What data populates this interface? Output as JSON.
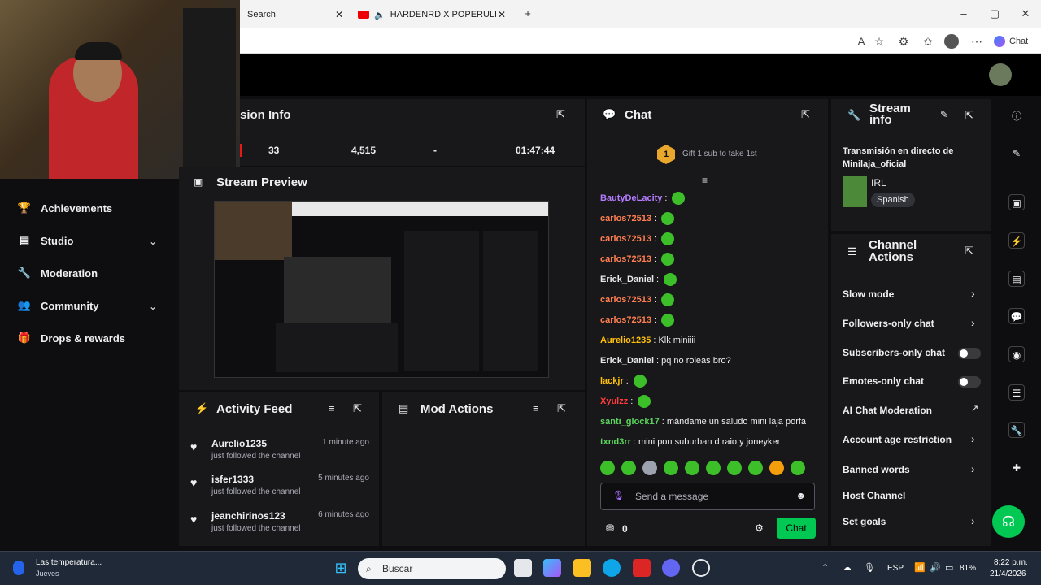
{
  "browser": {
    "tabs": [
      {
        "label": "Search"
      },
      {
        "label": "HARDENRD X POPERULIN - U"
      }
    ],
    "chat_button": "Chat"
  },
  "stats_bar": {
    "title_fragment": "sion Info",
    "values": [
      "33",
      "4,515",
      "-",
      "01:47:44"
    ]
  },
  "stream_preview": {
    "title": "Stream Preview"
  },
  "sidebar": {
    "items": [
      {
        "label": "Achievements",
        "icon": "trophy-icon",
        "expandable": false
      },
      {
        "label": "Studio",
        "icon": "studio-icon",
        "expandable": true
      },
      {
        "label": "Moderation",
        "icon": "wrench-icon",
        "expandable": false
      },
      {
        "label": "Community",
        "icon": "people-icon",
        "expandable": true
      },
      {
        "label": "Drops & rewards",
        "icon": "gift-icon",
        "expandable": false
      }
    ]
  },
  "activity_feed": {
    "title": "Activity Feed",
    "items": [
      {
        "user": "Aurelio1235",
        "time": "1 minute ago",
        "event": "just followed the channel"
      },
      {
        "user": "isfer1333",
        "time": "5 minutes ago",
        "event": "just followed the channel"
      },
      {
        "user": "jeanchirinos123",
        "time": "6 minutes ago",
        "event": "just followed the channel"
      }
    ]
  },
  "mod_actions": {
    "title": "Mod Actions"
  },
  "chat": {
    "title": "Chat",
    "gift_badge": "1",
    "gift_text": "Gift 1 sub to take 1st",
    "messages": [
      {
        "user": "BautyDeLacity",
        "color": "#b57cff",
        "text": "",
        "emote": true
      },
      {
        "user": "carlos72513",
        "color": "#ff7f50",
        "text": "",
        "emote": true
      },
      {
        "user": "carlos72513",
        "color": "#ff7f50",
        "text": "",
        "emote": true
      },
      {
        "user": "carlos72513",
        "color": "#ff7f50",
        "text": "",
        "emote": true
      },
      {
        "user": "Erick_Daniel",
        "color": "#e8e8e8",
        "text": "",
        "emote": true
      },
      {
        "user": "carlos72513",
        "color": "#ff7f50",
        "text": "",
        "emote": true
      },
      {
        "user": "carlos72513",
        "color": "#ff7f50",
        "text": "",
        "emote": true
      },
      {
        "user": "Aurelio1235",
        "color": "#ffc107",
        "text": "Klk miniiii",
        "emote": false
      },
      {
        "user": "Erick_Daniel",
        "color": "#e8e8e8",
        "text": "pq no roleas bro?",
        "emote": false
      },
      {
        "user": "lackjr",
        "color": "#ffc107",
        "text": "",
        "emote": true
      },
      {
        "user": "Xyulzz",
        "color": "#ff3b3b",
        "text": "",
        "emote": true
      },
      {
        "user": "santi_glock17",
        "color": "#5bd45b",
        "text": "mándame un saludo mini laja porfa",
        "emote": false
      },
      {
        "user": "txnd3rr",
        "color": "#5bd45b",
        "text": "mini pon suburban d raio y joneyker",
        "emote": false
      }
    ],
    "input_placeholder": "Send a message",
    "points": "0",
    "send_label": "Chat"
  },
  "stream_info": {
    "title": "Stream info",
    "stream_title": "Transmisión en directo de Minilaja_oficial",
    "category": "IRL",
    "tag": "Spanish"
  },
  "channel_actions": {
    "title": "Channel Actions",
    "items": [
      {
        "label": "Slow mode",
        "control": "arrow"
      },
      {
        "label": "Followers-only chat",
        "control": "arrow"
      },
      {
        "label": "Subscribers-only chat",
        "control": "toggle"
      },
      {
        "label": "Emotes-only chat",
        "control": "toggle"
      },
      {
        "label": "AI Chat Moderation",
        "control": "external"
      },
      {
        "label": "Account age restriction",
        "control": "arrow"
      },
      {
        "label": "Banned words",
        "control": "arrow"
      },
      {
        "label": "Host Channel",
        "control": "none"
      },
      {
        "label": "Set goals",
        "control": "arrow"
      }
    ]
  },
  "taskbar": {
    "weather_title": "Las temperatura...",
    "weather_sub": "Jueves",
    "search_placeholder": "Buscar",
    "lang": "ESP",
    "battery": "81%",
    "time": "8:22 p.m.",
    "date": "21/4/2026"
  },
  "colors": {
    "accent": "#00c853",
    "panel": "#18181b",
    "bg": "#0e0e10"
  }
}
